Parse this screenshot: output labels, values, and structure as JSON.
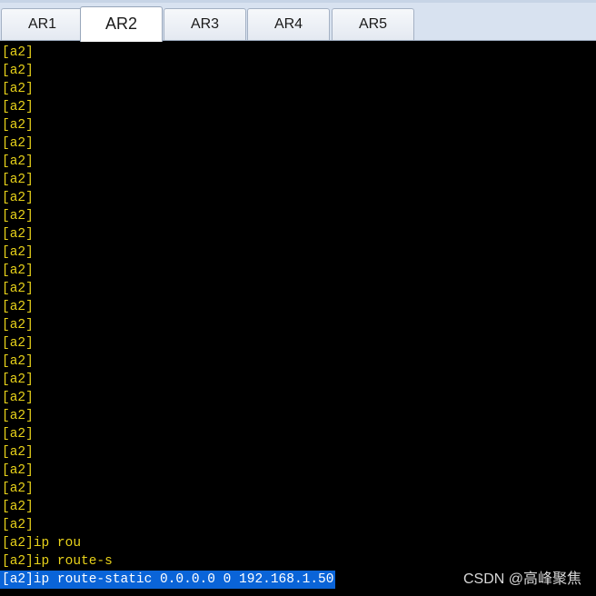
{
  "tabs": [
    {
      "label": "AR1",
      "active": false
    },
    {
      "label": "AR2",
      "active": true
    },
    {
      "label": "AR3",
      "active": false
    },
    {
      "label": "AR4",
      "active": false
    },
    {
      "label": "AR5",
      "active": false
    }
  ],
  "terminal": {
    "lines": [
      "[a2]",
      "[a2]",
      "[a2]",
      "[a2]",
      "[a2]",
      "[a2]",
      "[a2]",
      "[a2]",
      "[a2]",
      "[a2]",
      "[a2]",
      "[a2]",
      "[a2]",
      "[a2]",
      "[a2]",
      "[a2]",
      "[a2]",
      "[a2]",
      "[a2]",
      "[a2]",
      "[a2]",
      "[a2]",
      "[a2]",
      "[a2]",
      "[a2]",
      "[a2]",
      "[a2]",
      "[a2]ip rou",
      "[a2]ip route-s",
      "[a2]ip route-static 0.0.0.0 0 192.168.1.50"
    ],
    "selected_line_index": 29,
    "text_color": "#e8d21a",
    "selection_color": "#0a64d8"
  },
  "watermark": "CSDN @高峰聚焦"
}
